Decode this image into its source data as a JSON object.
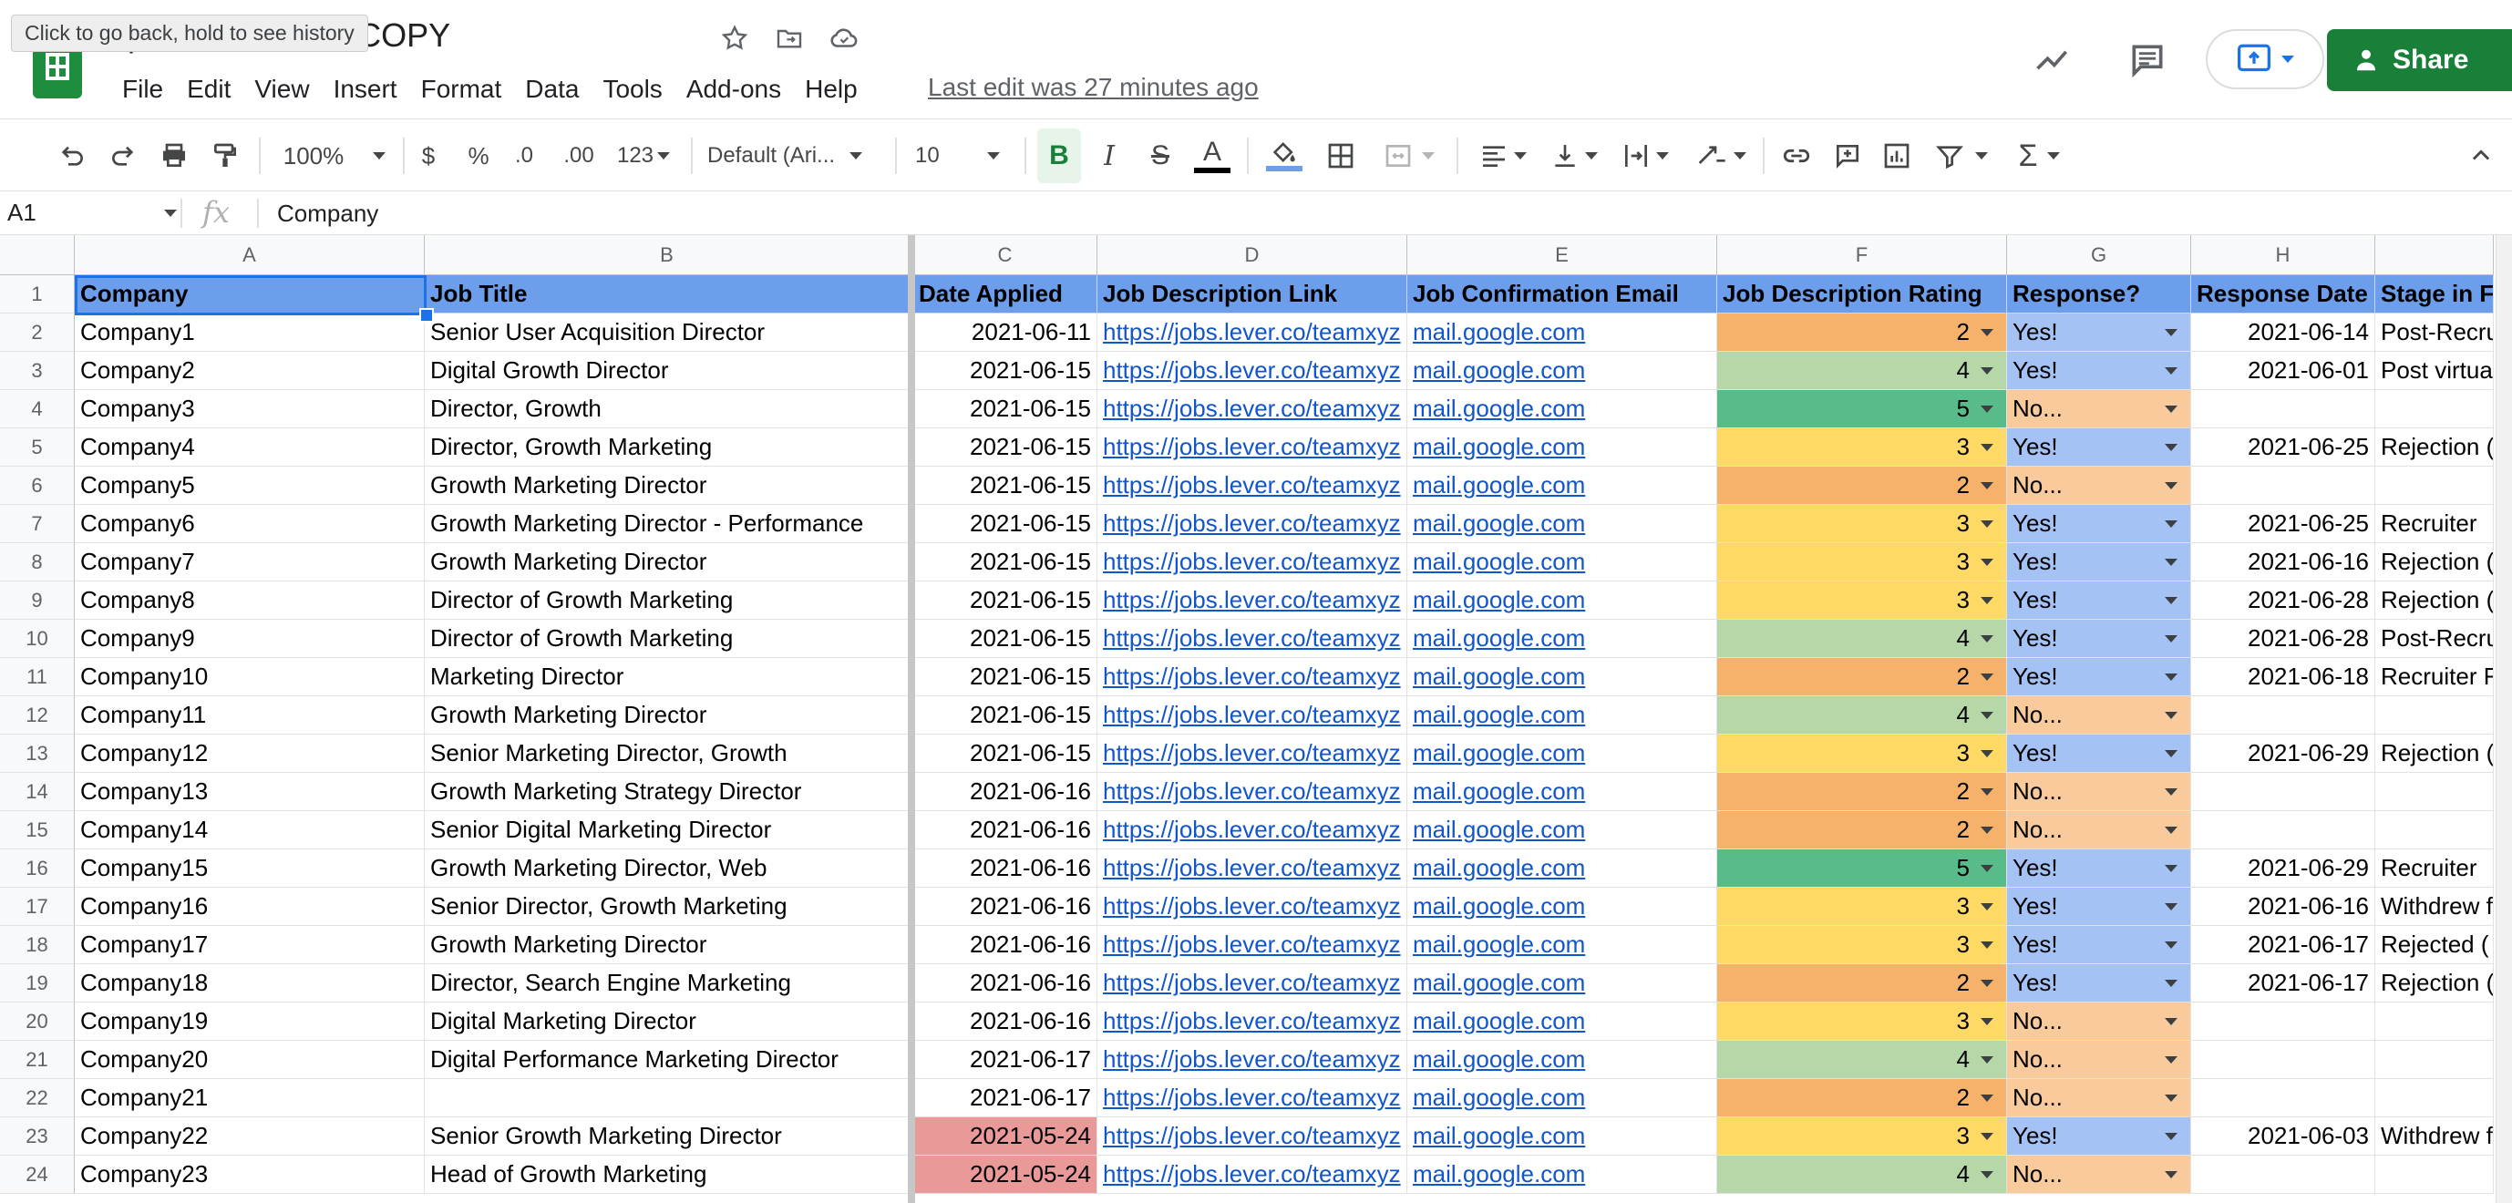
{
  "window": {
    "doc_title": "plate - MAKE A COPY",
    "tooltip": "Click to go back, hold to see history",
    "last_edit": "Last edit was 27 minutes ago",
    "share_label": "Share"
  },
  "menu": [
    "File",
    "Edit",
    "View",
    "Insert",
    "Format",
    "Data",
    "Tools",
    "Add-ons",
    "Help"
  ],
  "toolbar": {
    "zoom": "100%",
    "currency": "$",
    "percent": "%",
    "decrease_decimal": ".0",
    "increase_decimal": ".00",
    "more_formats": "123",
    "font": "Default (Ari...",
    "font_size": "10",
    "bold": "B",
    "italic": "I",
    "strikethrough": "S",
    "text_color": "A"
  },
  "formula_bar": {
    "cell_ref": "A1",
    "fx": "fx",
    "value": "Company"
  },
  "colors": {
    "header_fill": "#6d9eeb",
    "rating": {
      "2": "#f6b26b",
      "3": "#ffd966",
      "4": "#b6d7a8",
      "5": "#57bb8a"
    },
    "yes_fill": "#a4c2f4",
    "no_fill": "#f9cb9c",
    "date_highlight": "#ea9999",
    "link": "#1155cc",
    "share_button": "#188038"
  },
  "columns": [
    "A",
    "B",
    "C",
    "D",
    "E",
    "F",
    "G",
    "H",
    ""
  ],
  "header_row": [
    "Company",
    "Job Title",
    "Date Applied",
    "Job Description Link",
    "Job Confirmation Email",
    "Job Description Rating",
    "Response?",
    "Response Date",
    "Stage in F"
  ],
  "rows": [
    {
      "n": "2",
      "company": "Company1",
      "title": "Senior User Acquisition Director",
      "date": "2021-06-11",
      "link": "https://jobs.lever.co/teamxyz",
      "email": "mail.google.com",
      "rating": "2",
      "response": "Yes!",
      "resp_date": "2021-06-14",
      "stage": "Post-Recru"
    },
    {
      "n": "3",
      "company": "Company2",
      "title": "Digital Growth Director",
      "date": "2021-06-15",
      "link": "https://jobs.lever.co/teamxyz",
      "email": "mail.google.com",
      "rating": "4",
      "response": "Yes!",
      "resp_date": "2021-06-01",
      "stage": "Post virtua"
    },
    {
      "n": "4",
      "company": "Company3",
      "title": "Director, Growth",
      "date": "2021-06-15",
      "link": "https://jobs.lever.co/teamxyz",
      "email": "mail.google.com",
      "rating": "5",
      "response": "No...",
      "resp_date": "",
      "stage": ""
    },
    {
      "n": "5",
      "company": "Company4",
      "title": "Director, Growth Marketing",
      "date": "2021-06-15",
      "link": "https://jobs.lever.co/teamxyz",
      "email": "mail.google.com",
      "rating": "3",
      "response": "Yes!",
      "resp_date": "2021-06-25",
      "stage": "Rejection ("
    },
    {
      "n": "6",
      "company": "Company5",
      "title": "Growth Marketing Director",
      "date": "2021-06-15",
      "link": "https://jobs.lever.co/teamxyz",
      "email": "mail.google.com",
      "rating": "2",
      "response": "No...",
      "resp_date": "",
      "stage": ""
    },
    {
      "n": "7",
      "company": "Company6",
      "title": "Growth Marketing Director - Performance",
      "date": "2021-06-15",
      "link": "https://jobs.lever.co/teamxyz",
      "email": "mail.google.com",
      "rating": "3",
      "response": "Yes!",
      "resp_date": "2021-06-25",
      "stage": "Recruiter"
    },
    {
      "n": "8",
      "company": "Company7",
      "title": "Growth Marketing Director",
      "date": "2021-06-15",
      "link": "https://jobs.lever.co/teamxyz",
      "email": "mail.google.com",
      "rating": "3",
      "response": "Yes!",
      "resp_date": "2021-06-16",
      "stage": "Rejection ("
    },
    {
      "n": "9",
      "company": "Company8",
      "title": "Director of Growth Marketing",
      "date": "2021-06-15",
      "link": "https://jobs.lever.co/teamxyz",
      "email": "mail.google.com",
      "rating": "3",
      "response": "Yes!",
      "resp_date": "2021-06-28",
      "stage": "Rejection ("
    },
    {
      "n": "10",
      "company": "Company9",
      "title": "Director of Growth Marketing",
      "date": "2021-06-15",
      "link": "https://jobs.lever.co/teamxyz",
      "email": "mail.google.com",
      "rating": "4",
      "response": "Yes!",
      "resp_date": "2021-06-28",
      "stage": "Post-Recru"
    },
    {
      "n": "11",
      "company": "Company10",
      "title": "Marketing Director",
      "date": "2021-06-15",
      "link": "https://jobs.lever.co/teamxyz",
      "email": "mail.google.com",
      "rating": "2",
      "response": "Yes!",
      "resp_date": "2021-06-18",
      "stage": "Recruiter F"
    },
    {
      "n": "12",
      "company": "Company11",
      "title": "Growth Marketing Director",
      "date": "2021-06-15",
      "link": "https://jobs.lever.co/teamxyz",
      "email": "mail.google.com",
      "rating": "4",
      "response": "No...",
      "resp_date": "",
      "stage": ""
    },
    {
      "n": "13",
      "company": "Company12",
      "title": "Senior Marketing Director, Growth",
      "date": "2021-06-15",
      "link": "https://jobs.lever.co/teamxyz",
      "email": "mail.google.com",
      "rating": "3",
      "response": "Yes!",
      "resp_date": "2021-06-29",
      "stage": "Rejection ("
    },
    {
      "n": "14",
      "company": "Company13",
      "title": "Growth Marketing Strategy Director",
      "date": "2021-06-16",
      "link": "https://jobs.lever.co/teamxyz",
      "email": "mail.google.com",
      "rating": "2",
      "response": "No...",
      "resp_date": "",
      "stage": ""
    },
    {
      "n": "15",
      "company": "Company14",
      "title": "Senior Digital Marketing Director",
      "date": "2021-06-16",
      "link": "https://jobs.lever.co/teamxyz",
      "email": "mail.google.com",
      "rating": "2",
      "response": "No...",
      "resp_date": "",
      "stage": ""
    },
    {
      "n": "16",
      "company": "Company15",
      "title": "Growth Marketing Director, Web",
      "date": "2021-06-16",
      "link": "https://jobs.lever.co/teamxyz",
      "email": "mail.google.com",
      "rating": "5",
      "response": "Yes!",
      "resp_date": "2021-06-29",
      "stage": "Recruiter"
    },
    {
      "n": "17",
      "company": "Company16",
      "title": "Senior Director, Growth Marketing",
      "date": "2021-06-16",
      "link": "https://jobs.lever.co/teamxyz",
      "email": "mail.google.com",
      "rating": "3",
      "response": "Yes!",
      "resp_date": "2021-06-16",
      "stage": "Withdrew f"
    },
    {
      "n": "18",
      "company": "Company17",
      "title": "Growth Marketing Director",
      "date": "2021-06-16",
      "link": "https://jobs.lever.co/teamxyz",
      "email": "mail.google.com",
      "rating": "3",
      "response": "Yes!",
      "resp_date": "2021-06-17",
      "stage": "Rejected ("
    },
    {
      "n": "19",
      "company": "Company18",
      "title": "Director, Search Engine Marketing",
      "date": "2021-06-16",
      "link": "https://jobs.lever.co/teamxyz",
      "email": "mail.google.com",
      "rating": "2",
      "response": "Yes!",
      "resp_date": "2021-06-17",
      "stage": "Rejection ("
    },
    {
      "n": "20",
      "company": "Company19",
      "title": "Digital Marketing Director",
      "date": "2021-06-16",
      "link": "https://jobs.lever.co/teamxyz",
      "email": "mail.google.com",
      "rating": "3",
      "response": "No...",
      "resp_date": "",
      "stage": ""
    },
    {
      "n": "21",
      "company": "Company20",
      "title": "Digital Performance Marketing Director",
      "date": "2021-06-17",
      "link": "https://jobs.lever.co/teamxyz",
      "email": "mail.google.com",
      "rating": "4",
      "response": "No...",
      "resp_date": "",
      "stage": ""
    },
    {
      "n": "22",
      "company": "Company21",
      "title": "",
      "date": "2021-06-17",
      "link": "https://jobs.lever.co/teamxyz",
      "email": "mail.google.com",
      "rating": "2",
      "response": "No...",
      "resp_date": "",
      "stage": ""
    },
    {
      "n": "23",
      "company": "Company22",
      "title": "Senior Growth Marketing Director",
      "date": "2021-05-24",
      "date_flag": true,
      "link": "https://jobs.lever.co/teamxyz",
      "email": "mail.google.com",
      "rating": "3",
      "response": "Yes!",
      "resp_date": "2021-06-03",
      "stage": "Withdrew f"
    },
    {
      "n": "24",
      "company": "Company23",
      "title": "Head of Growth Marketing",
      "date": "2021-05-24",
      "date_flag": true,
      "link": "https://jobs.lever.co/teamxyz",
      "email": "mail.google.com",
      "rating": "4",
      "response": "No...",
      "resp_date": "",
      "stage": ""
    }
  ]
}
